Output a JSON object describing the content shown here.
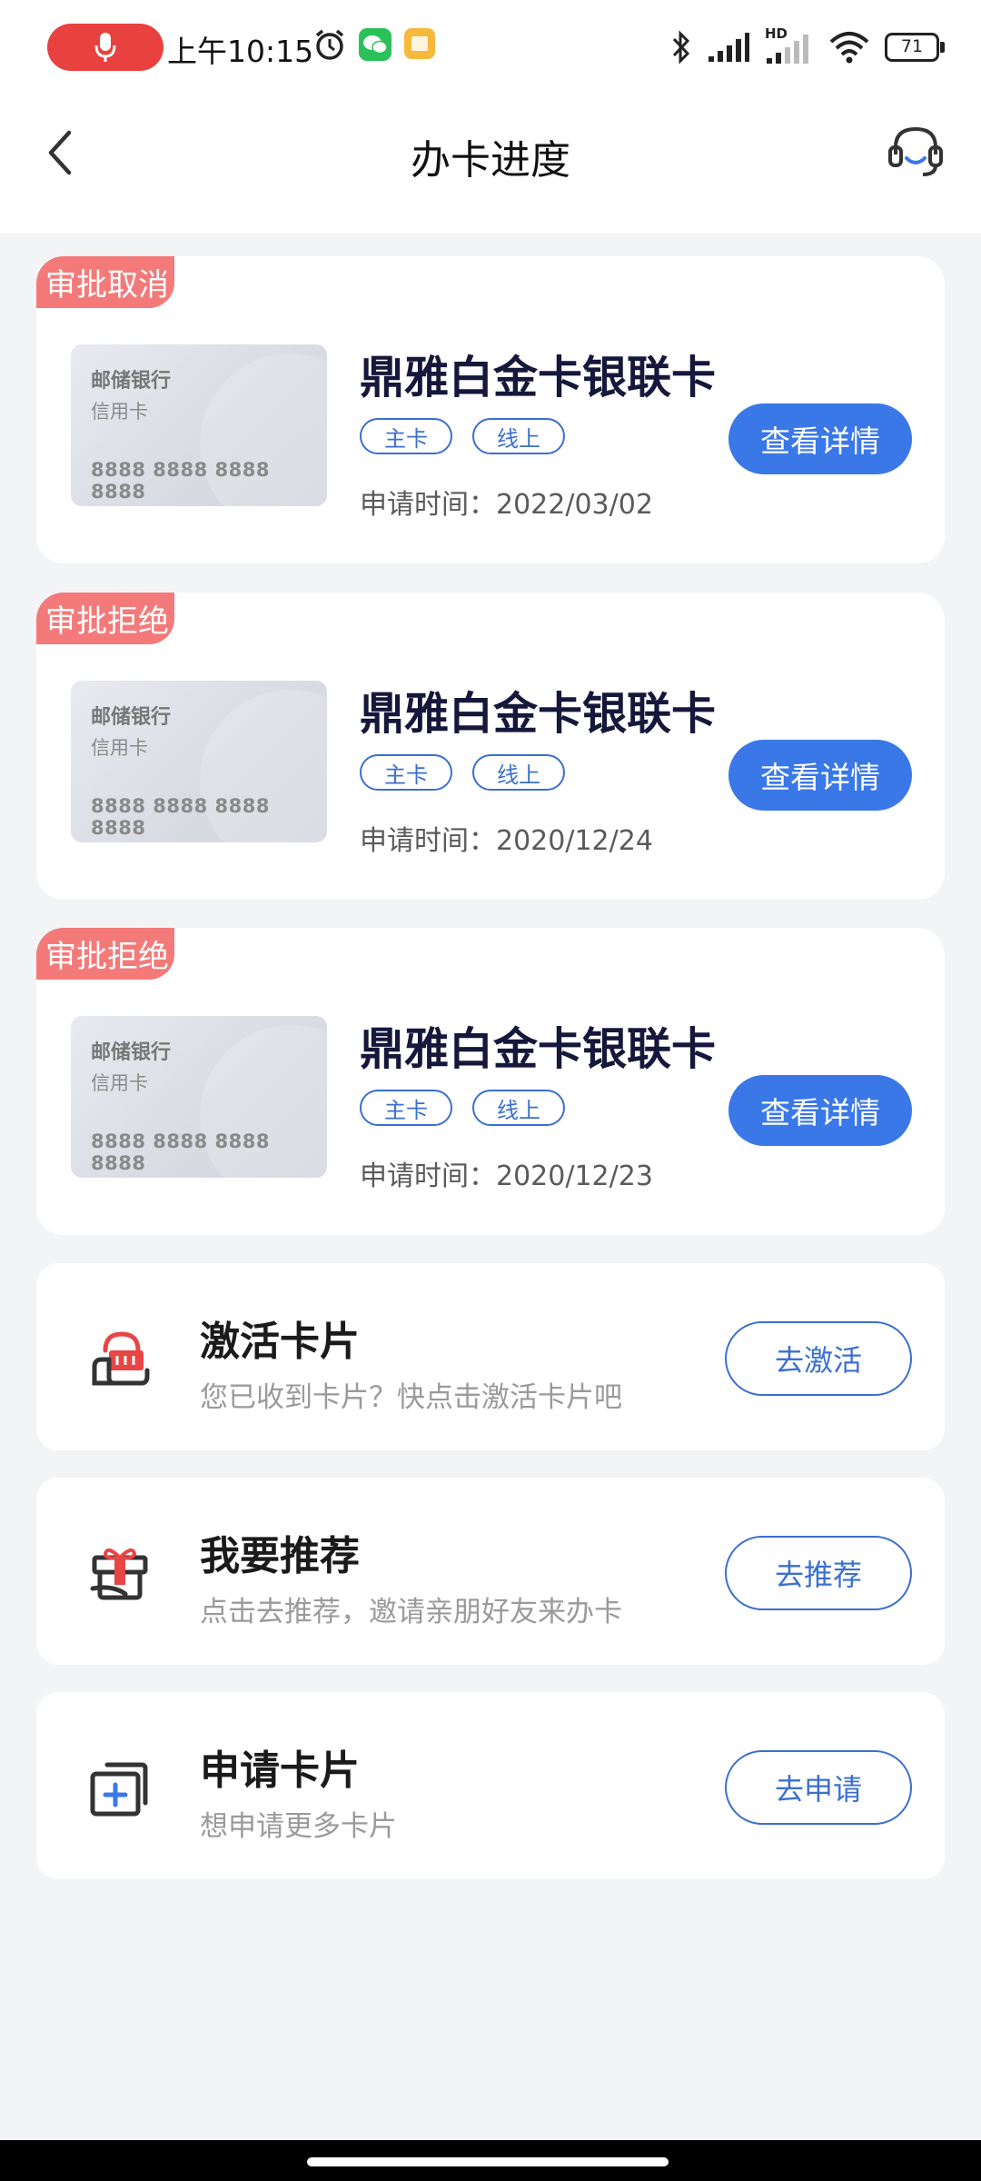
{
  "status_bar": {
    "time": "上午10:15",
    "battery": "71",
    "signal_label": "HD"
  },
  "header": {
    "title": "办卡进度"
  },
  "progress_cards": [
    {
      "status": "审批取消",
      "card_name": "鼎雅白金卡银联卡",
      "tags": [
        "主卡",
        "线上"
      ],
      "apply_date": "申请时间：2022/03/02",
      "button": "查看详情",
      "thumb": {
        "bank": "邮储银行",
        "type": "信用卡",
        "number": "8888 8888 8888 8888"
      }
    },
    {
      "status": "审批拒绝",
      "card_name": "鼎雅白金卡银联卡",
      "tags": [
        "主卡",
        "线上"
      ],
      "apply_date": "申请时间：2020/12/24",
      "button": "查看详情",
      "thumb": {
        "bank": "邮储银行",
        "type": "信用卡",
        "number": "8888 8888 8888 8888"
      }
    },
    {
      "status": "审批拒绝",
      "card_name": "鼎雅白金卡银联卡",
      "tags": [
        "主卡",
        "线上"
      ],
      "apply_date": "申请时间：2020/12/23",
      "button": "查看详情",
      "thumb": {
        "bank": "邮储银行",
        "type": "信用卡",
        "number": "8888 8888 8888 8888"
      }
    }
  ],
  "actions": [
    {
      "icon": "activate-card-icon",
      "title": "激活卡片",
      "desc": "您已收到卡片？快点击激活卡片吧",
      "button": "去激活"
    },
    {
      "icon": "gift-recommend-icon",
      "title": "我要推荐",
      "desc": "点击去推荐，邀请亲朋好友来办卡",
      "button": "去推荐"
    },
    {
      "icon": "apply-card-icon",
      "title": "申请卡片",
      "desc": "想申请更多卡片",
      "button": "去申请"
    }
  ],
  "colors": {
    "accent": "#3a78e8",
    "status_tag": "#f47a7a",
    "background": "#f3f4f6"
  }
}
